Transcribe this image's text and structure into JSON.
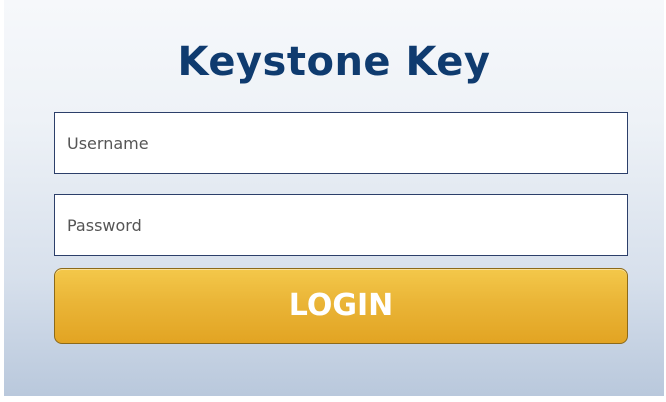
{
  "app": {
    "title": "Keystone Key"
  },
  "form": {
    "username": {
      "placeholder": "Username",
      "value": ""
    },
    "password": {
      "placeholder": "Password",
      "value": ""
    },
    "login_label": "LOGIN"
  },
  "colors": {
    "title": "#0f3b6f",
    "button": "#eab537",
    "field_border": "#2c3f6a"
  }
}
